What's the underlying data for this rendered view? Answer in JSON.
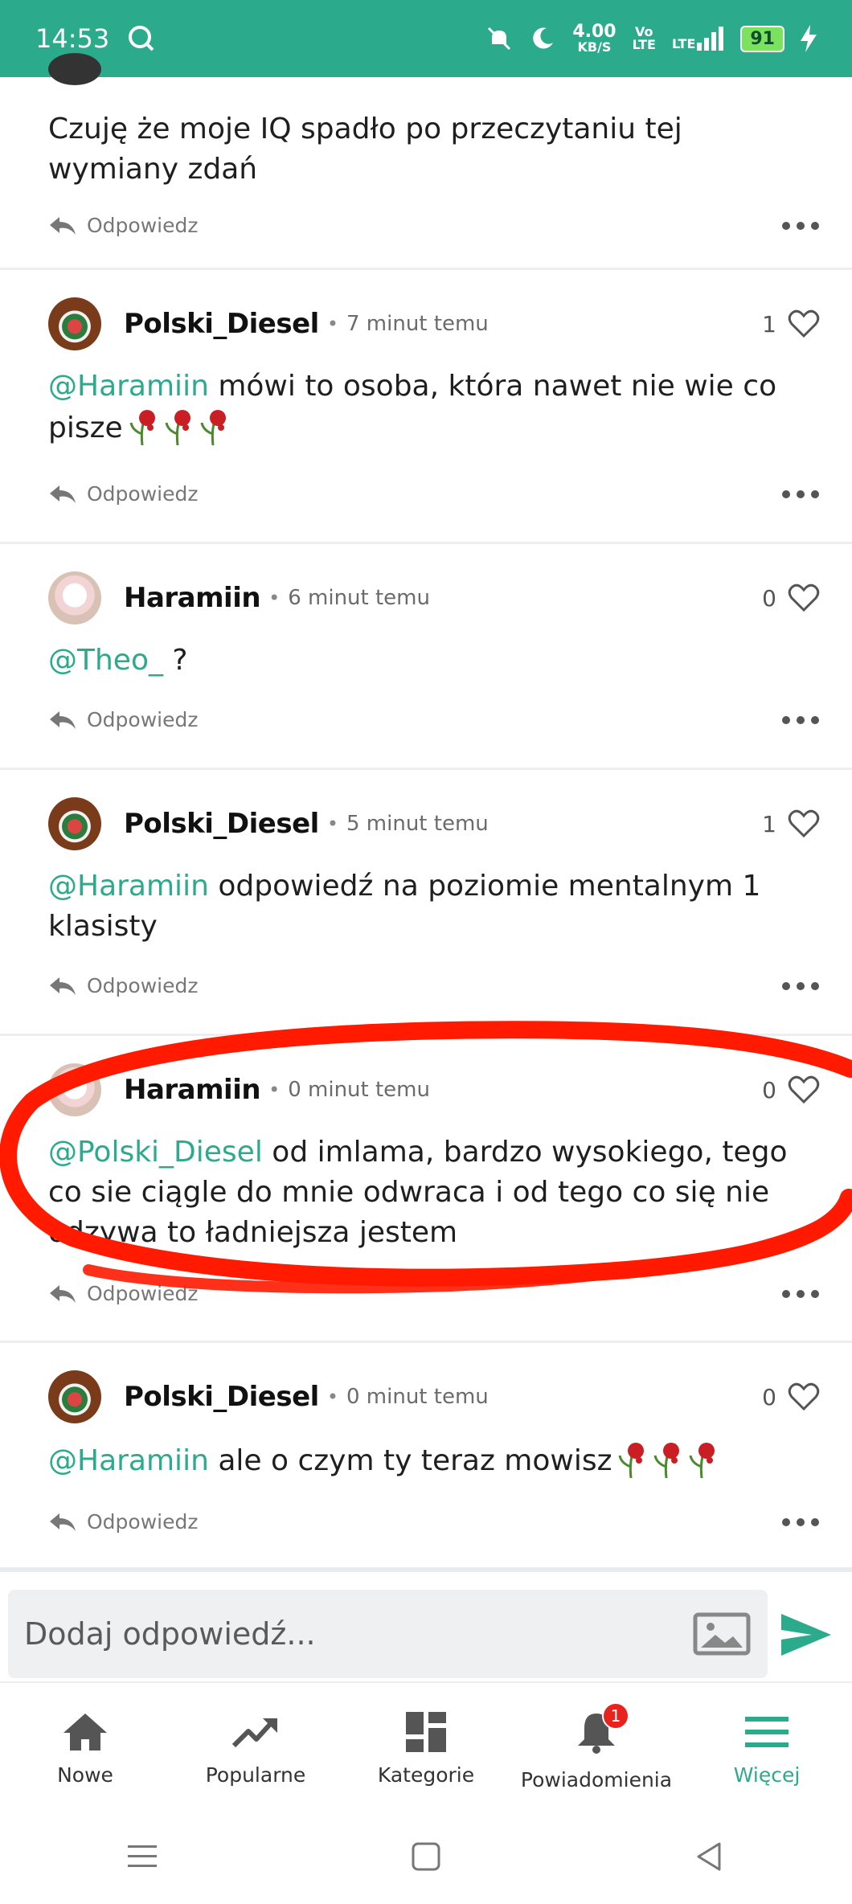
{
  "status_bar": {
    "time": "14:53",
    "speed_value": "4.00",
    "speed_unit": "KB/S",
    "volte_top": "Vo",
    "volte_bottom": "LTE",
    "network": "LTE",
    "battery": "91"
  },
  "comments": [
    {
      "text": "Czuję że moje IQ spadło po przeczytaniu tej wymiany zdań",
      "reply_label": "Odpowiedz"
    },
    {
      "user": "Polski_Diesel",
      "time": "7 minut temu",
      "likes": "1",
      "mention": "@Haramiin",
      "text": " mówi to osoba, która nawet nie wie co pisze",
      "reply_label": "Odpowiedz"
    },
    {
      "user": "Haramiin",
      "time": "6 minut temu",
      "likes": "0",
      "mention": "@Theo_",
      "text": " ?",
      "reply_label": "Odpowiedz"
    },
    {
      "user": "Polski_Diesel",
      "time": "5 minut temu",
      "likes": "1",
      "mention": "@Haramiin",
      "text": " odpowiedź na poziomie mentalnym 1 klasisty",
      "reply_label": "Odpowiedz"
    },
    {
      "user": "Haramiin",
      "time": "0 minut temu",
      "likes": "0",
      "mention": "@Polski_Diesel",
      "text": " od imlama, bardzo wysokiego, tego co sie ciągle do mnie odwraca i od tego co się nie odzywa to ładniejsza jestem",
      "reply_label": "Odpowiedz"
    },
    {
      "user": "Polski_Diesel",
      "time": "0 minut temu",
      "likes": "0",
      "mention": "@Haramiin",
      "text": " ale o czym ty teraz mowisz",
      "reply_label": "Odpowiedz"
    }
  ],
  "reply_bar": {
    "placeholder": "Dodaj odpowiedź..."
  },
  "nav": {
    "items": [
      {
        "label": "Nowe",
        "icon": "home-icon"
      },
      {
        "label": "Popularne",
        "icon": "trending-icon"
      },
      {
        "label": "Kategorie",
        "icon": "grid-icon"
      },
      {
        "label": "Powiadomienia",
        "icon": "bell-icon",
        "badge": "1"
      },
      {
        "label": "Więcej",
        "icon": "menu-icon",
        "active": true
      }
    ]
  },
  "colors": {
    "accent": "#2bab8c",
    "annotation_red": "#ff1a00",
    "badge_red": "#e8231e"
  }
}
